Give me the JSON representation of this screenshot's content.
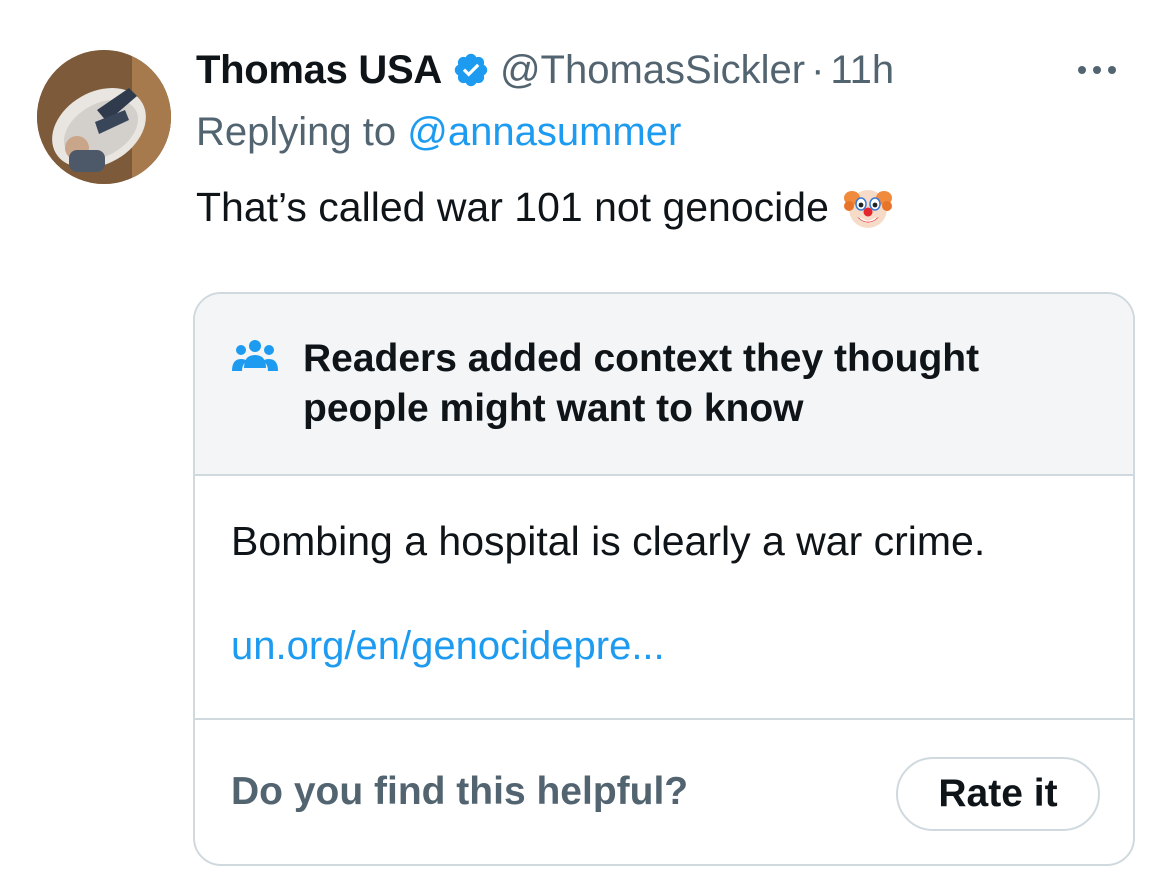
{
  "author": {
    "name": "Thomas USA",
    "handle": "@ThomasSickler",
    "separator": "·",
    "time": "11h",
    "avatar_icon": "profile-photo",
    "verified_icon": "verified-badge-icon"
  },
  "reply": {
    "prefix": "Replying to",
    "mention": "@annasummer"
  },
  "tweet": {
    "text": "That’s called war 101 not genocide",
    "emoji_icon": "clown-face-emoji"
  },
  "menu": {
    "icon": "more-options-icon"
  },
  "community_note": {
    "header_icon": "people-group-icon",
    "title": "Readers added context they thought people might want to know",
    "body": "Bombing a hospital is clearly a war crime.",
    "link": "un.org/en/genocidepre...",
    "prompt": "Do you find this helpful?",
    "rate_label": "Rate it"
  },
  "colors": {
    "accent": "#1d9bf0",
    "secondary_text": "#536471",
    "primary_text": "#0f1419",
    "border": "#cfd9de",
    "note_header_bg": "#f3f5f6"
  }
}
